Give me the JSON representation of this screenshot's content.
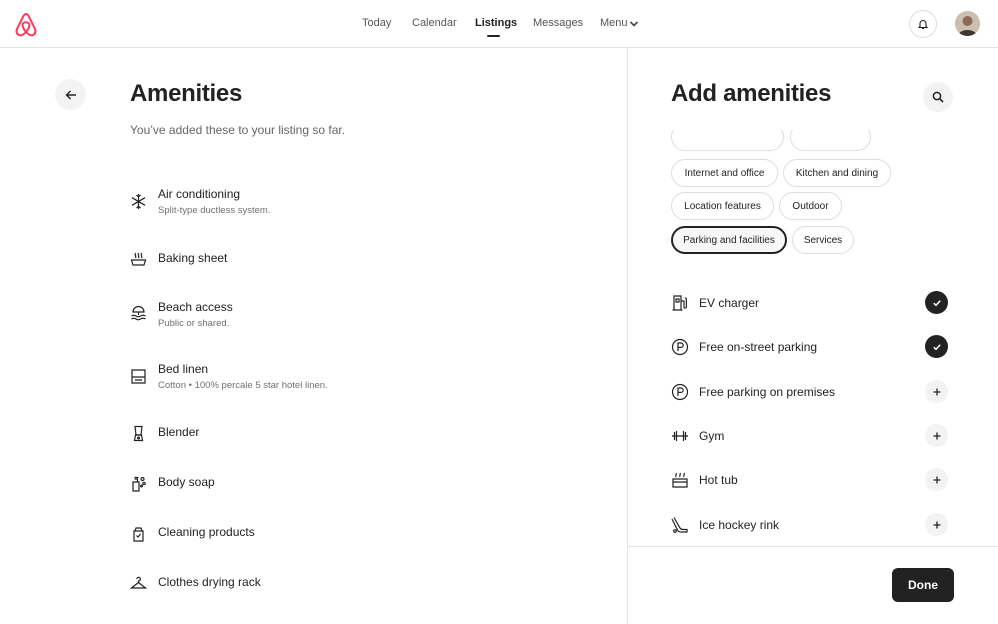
{
  "nav": {
    "items": [
      "Today",
      "Calendar",
      "Listings",
      "Messages",
      "Menu"
    ],
    "active": "Listings"
  },
  "left": {
    "title": "Amenities",
    "subtitle": "You’ve added these to your listing so far.",
    "amenities": [
      {
        "name": "Air conditioning",
        "desc": "Split-type ductless system.",
        "icon": "snowflake-icon"
      },
      {
        "name": "Baking sheet",
        "desc": "",
        "icon": "baking-sheet-icon"
      },
      {
        "name": "Beach access",
        "desc": "Public or shared.",
        "icon": "beach-icon"
      },
      {
        "name": "Bed linen",
        "desc": "Cotton • 100% percale 5 star hotel linen.",
        "icon": "bed-linen-icon"
      },
      {
        "name": "Blender",
        "desc": "",
        "icon": "blender-icon"
      },
      {
        "name": "Body soap",
        "desc": "",
        "icon": "soap-icon"
      },
      {
        "name": "Cleaning products",
        "desc": "",
        "icon": "cleaning-icon"
      },
      {
        "name": "Clothes drying rack",
        "desc": "",
        "icon": "hanger-icon"
      }
    ]
  },
  "right": {
    "title": "Add amenities",
    "chips": [
      "Internet and office",
      "Kitchen and dining",
      "Location features",
      "Outdoor",
      "Parking and facilities",
      "Services"
    ],
    "selected_chip": "Parking and facilities",
    "options": [
      {
        "name": "EV charger",
        "added": true,
        "icon": "ev-charger-icon"
      },
      {
        "name": "Free on-street parking",
        "added": true,
        "icon": "parking-icon"
      },
      {
        "name": "Free parking on premises",
        "added": false,
        "icon": "parking-icon"
      },
      {
        "name": "Gym",
        "added": false,
        "icon": "gym-icon"
      },
      {
        "name": "Hot tub",
        "added": false,
        "icon": "hot-tub-icon"
      },
      {
        "name": "Ice hockey rink",
        "added": false,
        "icon": "hockey-icon"
      }
    ],
    "done_label": "Done"
  },
  "colors": {
    "brand": "#FF385C",
    "text": "#222222",
    "muted": "#717171"
  }
}
